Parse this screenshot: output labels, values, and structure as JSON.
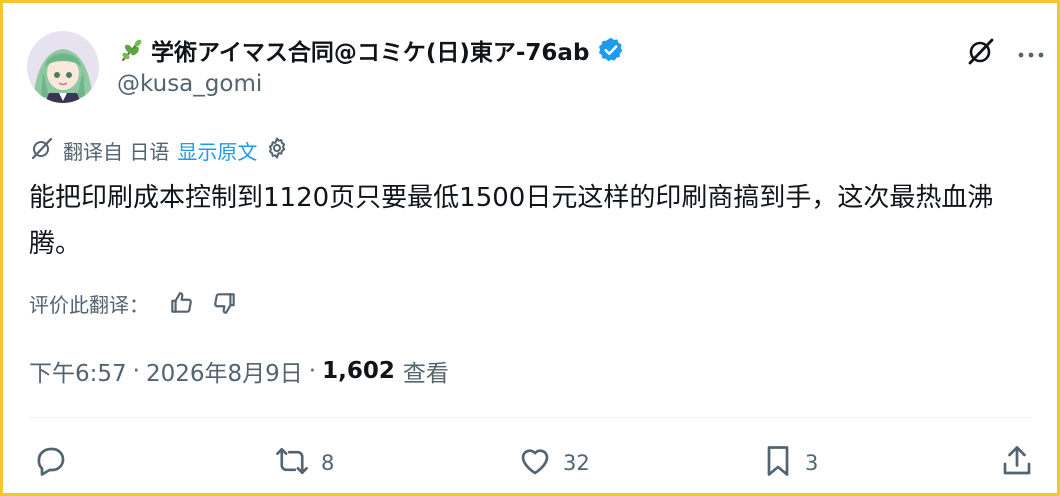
{
  "tweet": {
    "display_name": "学術アイマス合同@コミケ(日)東ア-76ab",
    "handle": "@kusa_gomi",
    "translation": {
      "translated_from": "翻译自 日语",
      "show_original": "显示原文"
    },
    "text": "能把印刷成本控制到1120页只要最低1500日元这样的印刷商搞到手，这次最热血沸腾。",
    "rate_translation": "评价此翻译：",
    "time": "下午6:57",
    "date": "2026年8月9日",
    "separator": "·",
    "views_count": "1,602",
    "views_label": "查看",
    "actions": {
      "replies": "",
      "retweets": "8",
      "likes": "32",
      "bookmarks": "3"
    }
  },
  "colors": {
    "frame": "#f3c62f",
    "text": "#0f1419",
    "secondary": "#536471",
    "accent": "#1d9bf0"
  },
  "icons": [
    "sprout-icon",
    "verified-badge-icon",
    "grok-icon",
    "more-icon",
    "translate-icon",
    "gear-icon",
    "thumbs-up-icon",
    "thumbs-down-icon",
    "reply-icon",
    "retweet-icon",
    "like-icon",
    "bookmark-icon",
    "share-icon"
  ]
}
